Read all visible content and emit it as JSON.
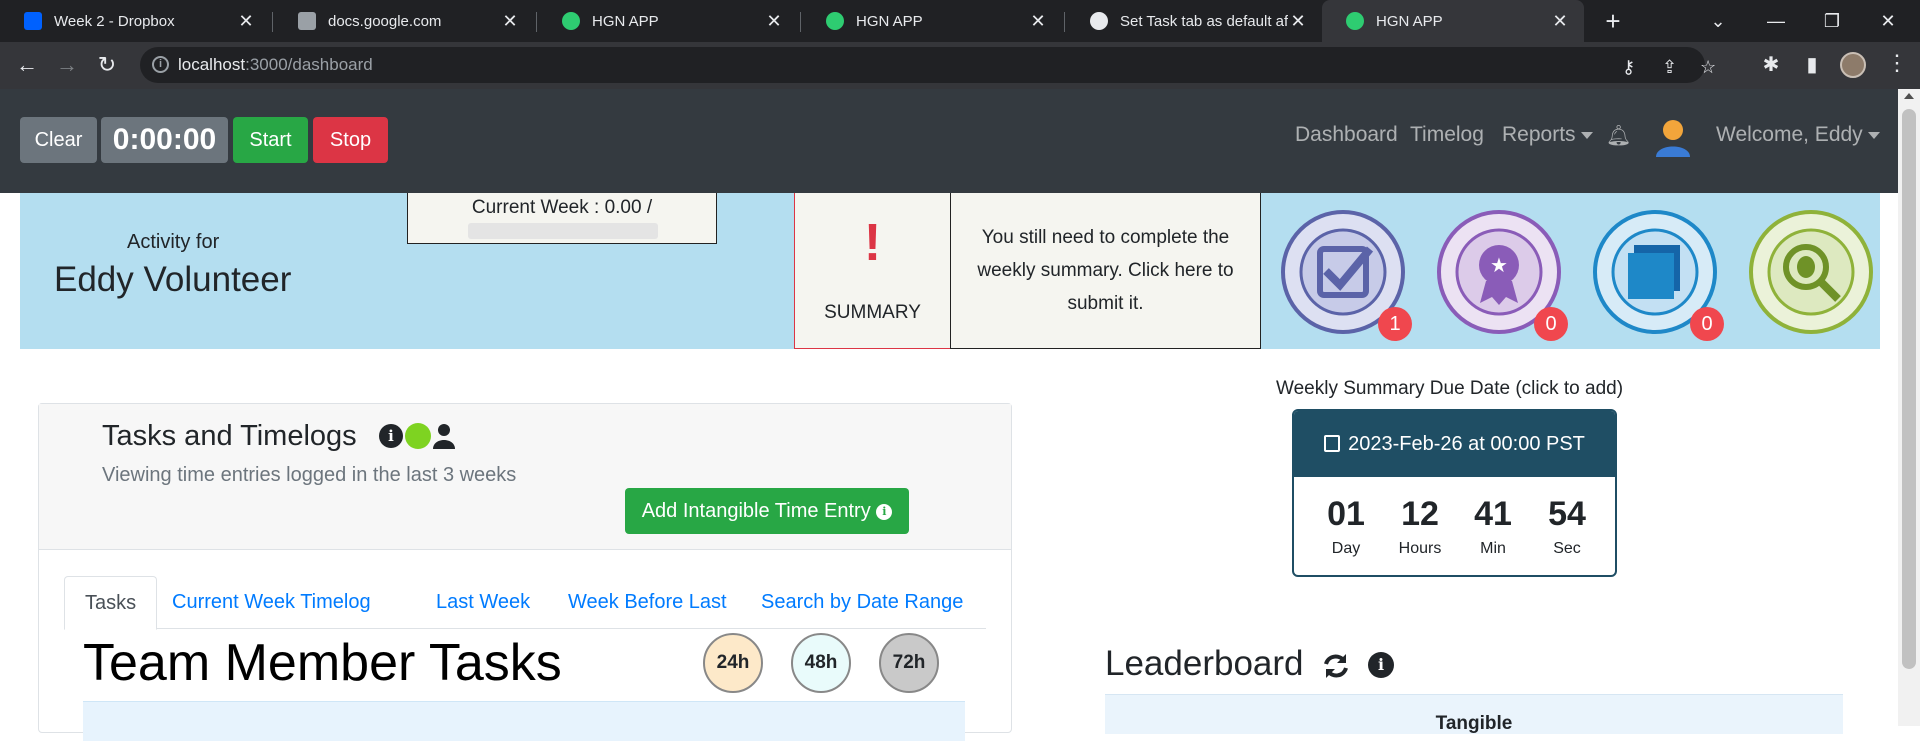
{
  "browser": {
    "tabs": [
      {
        "title": "Week 2 - Dropbox",
        "icon": "dropbox-icon",
        "color": "#0061fe"
      },
      {
        "title": "docs.google.com",
        "icon": "document-icon",
        "color": "#9aa0a6"
      },
      {
        "title": "HGN APP",
        "icon": "hgn-icon",
        "color": "#2ecc71"
      },
      {
        "title": "HGN APP",
        "icon": "hgn-icon",
        "color": "#2ecc71"
      },
      {
        "title": "Set Task tab as default after...",
        "icon": "github-icon",
        "color": "#e8eaed"
      },
      {
        "title": "HGN APP",
        "icon": "hgn-icon",
        "color": "#2ecc71"
      }
    ],
    "active_tab": 5,
    "url_host": "localhost",
    "url_path": ":3000/dashboard"
  },
  "appnav": {
    "clear_label": "Clear",
    "timer": "0:00:00",
    "start_label": "Start",
    "stop_label": "Stop",
    "links": {
      "dashboard": "Dashboard",
      "timelog": "Timelog",
      "reports": "Reports",
      "welcome": "Welcome, Eddy"
    }
  },
  "banner": {
    "activity_label": "Activity for",
    "user_name": "Eddy Volunteer",
    "current_week": "Current Week : 0.00 /",
    "summary_mark": "!",
    "summary_label": "SUMMARY",
    "summary_message": "You still need to complete the weekly summary. Click here to submit it.",
    "badges": [
      {
        "name": "tasks-badge",
        "count": "1",
        "color": "#5b63a8"
      },
      {
        "name": "badges-earned-badge",
        "count": "0",
        "color": "#8a5cb8"
      },
      {
        "name": "blue-square-badge",
        "count": "0",
        "color": "#1e88c8"
      },
      {
        "name": "report-app-bug-badge",
        "count": "",
        "color": "#8fb23a"
      }
    ]
  },
  "tasks": {
    "title": "Tasks and Timelogs",
    "subtitle": "Viewing time entries logged in the last 3 weeks",
    "add_intangible": "Add Intangible Time Entry",
    "tabs": [
      "Tasks",
      "Current Week Timelog",
      "Last Week",
      "Week Before Last",
      "Search by Date Range"
    ],
    "team_title": "Team Member Tasks",
    "hour_filters": [
      "24h",
      "48h",
      "72h"
    ],
    "hour_filter_colors": [
      "#fde9c9",
      "#e9fbfb",
      "#c9c9c9"
    ]
  },
  "summary_due": {
    "label": "Weekly Summary Due Date (click to add)",
    "date": "2023-Feb-26 at 00:00 PST",
    "units": [
      {
        "value": "01",
        "label": "Day"
      },
      {
        "value": "12",
        "label": "Hours"
      },
      {
        "value": "41",
        "label": "Min"
      },
      {
        "value": "54",
        "label": "Sec"
      }
    ]
  },
  "leaderboard": {
    "title": "Leaderboard",
    "column": "Tangible"
  }
}
